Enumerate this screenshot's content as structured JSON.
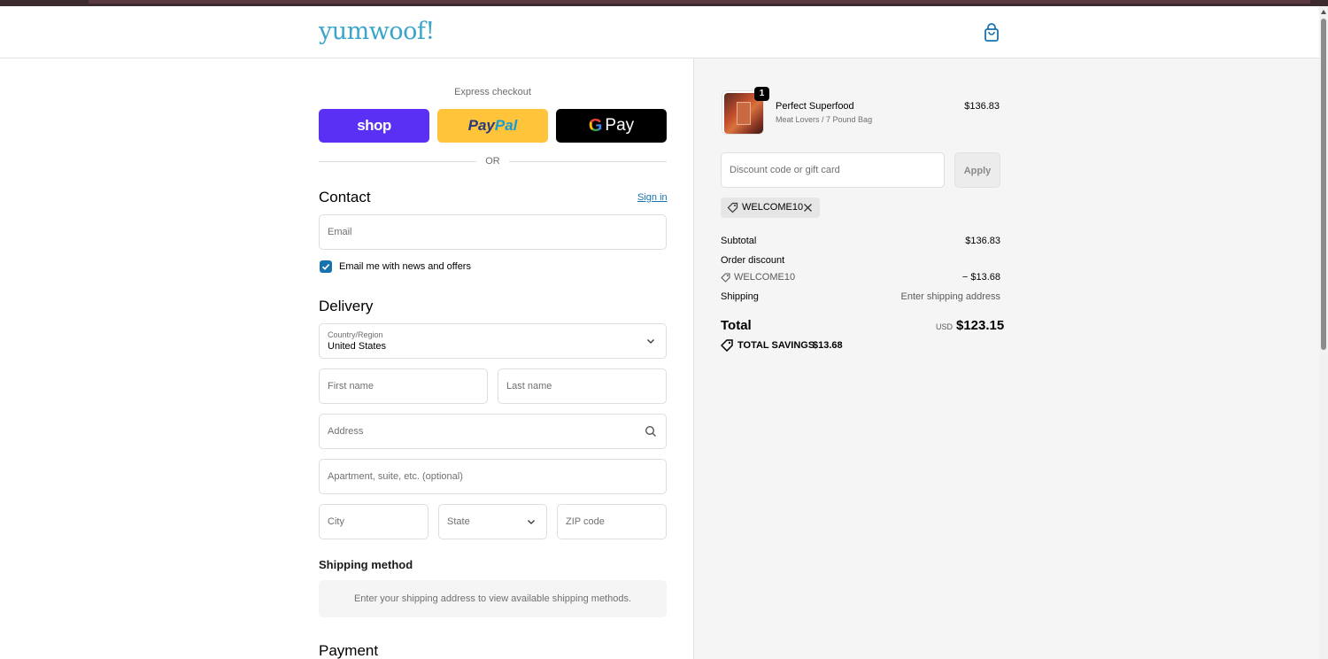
{
  "header": {
    "logo": "yumwoof!",
    "cart_icon": "shopping-bag-icon"
  },
  "express": {
    "label": "Express checkout",
    "shop_label": "shop",
    "paypal_part1": "Pay",
    "paypal_part2": "Pal",
    "gpay_g": "G",
    "gpay_label": "Pay",
    "or_label": "OR"
  },
  "contact": {
    "title": "Contact",
    "signin": "Sign in",
    "email_placeholder": "Email",
    "newsletter_label": "Email me with news and offers",
    "newsletter_checked": true
  },
  "delivery": {
    "title": "Delivery",
    "country_label": "Country/Region",
    "country_value": "United States",
    "first_name": "First name",
    "last_name": "Last name",
    "address": "Address",
    "apartment": "Apartment, suite, etc. (optional)",
    "city": "City",
    "state": "State",
    "zip": "ZIP code"
  },
  "shipping": {
    "title": "Shipping method",
    "message": "Enter your shipping address to view available shipping methods."
  },
  "payment": {
    "title": "Payment"
  },
  "order": {
    "product_name": "Perfect Superfood",
    "product_variant": "Meat Lovers / 7 Pound Bag",
    "product_price": "$136.83",
    "quantity": "1",
    "discount_placeholder": "Discount code or gift card",
    "apply_label": "Apply",
    "applied_code": "WELCOME10",
    "subtotal_label": "Subtotal",
    "subtotal_value": "$136.83",
    "discount_label": "Order discount",
    "discount_code": "WELCOME10",
    "discount_value": "− $13.68",
    "shipping_label": "Shipping",
    "shipping_value": "Enter shipping address",
    "total_label": "Total",
    "total_currency": "USD",
    "total_value": "$123.15",
    "savings_label": "TOTAL SAVINGS",
    "savings_value": "$13.68"
  },
  "colors": {
    "brand": "#3aa5c9",
    "accent": "#1773b0",
    "shop_pay": "#5a31f4",
    "paypal": "#ffc439"
  }
}
